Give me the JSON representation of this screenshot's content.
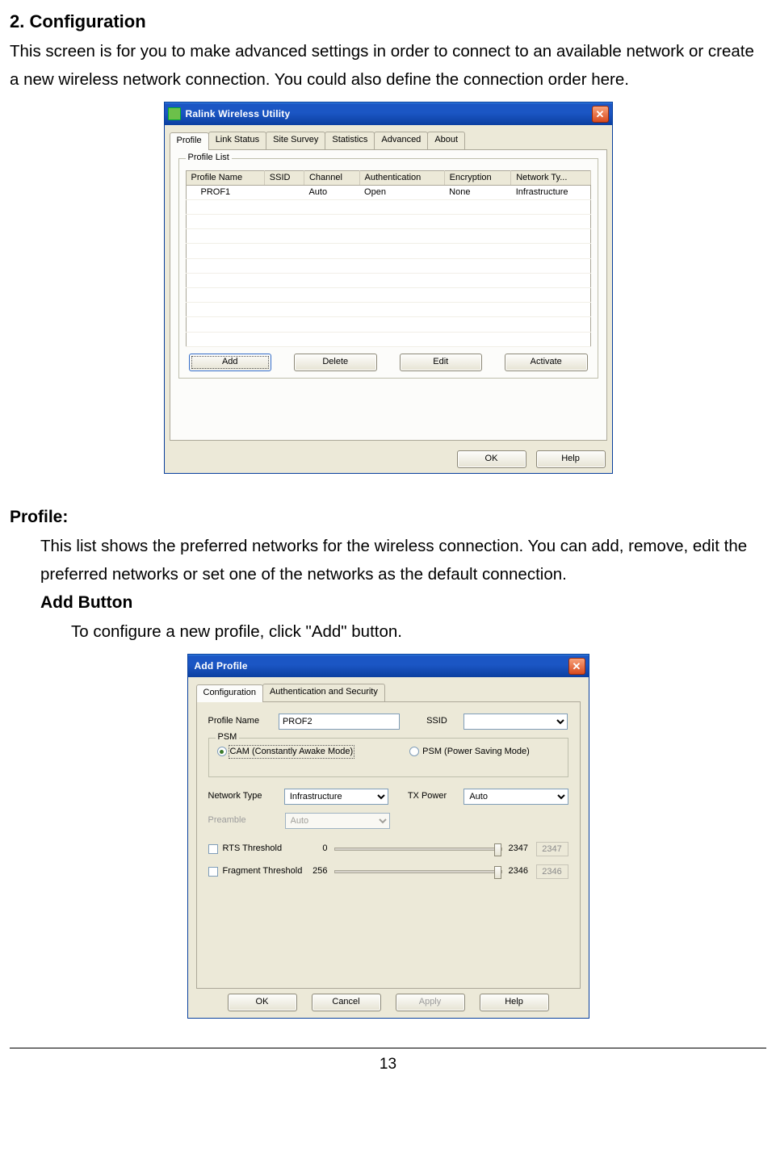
{
  "section": {
    "heading": "2. Configuration",
    "intro": "This screen is for you to make advanced settings in order to connect to an available network or create a new wireless network connection. You could also define the connection order here."
  },
  "profile_section": {
    "heading": "Profile:",
    "text": "This list shows the preferred networks for the wireless connection. You can add, remove, edit the preferred networks or set one of the networks as the default connection.",
    "add_heading": "Add Button",
    "add_text": "To configure a new profile, click \"Add\" button."
  },
  "fig1": {
    "title": "Ralink Wireless Utility",
    "tabs": [
      "Profile",
      "Link Status",
      "Site Survey",
      "Statistics",
      "Advanced",
      "About"
    ],
    "group_label": "Profile List",
    "columns": [
      "Profile Name",
      "SSID",
      "Channel",
      "Authentication",
      "Encryption",
      "Network Ty..."
    ],
    "row": {
      "name": "PROF1",
      "ssid": "",
      "channel": "Auto",
      "auth": "Open",
      "enc": "None",
      "ntype": "Infrastructure"
    },
    "buttons": {
      "add": "Add",
      "delete": "Delete",
      "edit": "Edit",
      "activate": "Activate"
    },
    "bottom": {
      "ok": "OK",
      "help": "Help"
    }
  },
  "fig2": {
    "title": "Add Profile",
    "tabs": [
      "Configuration",
      "Authentication and Security"
    ],
    "labels": {
      "profile_name": "Profile Name",
      "ssid": "SSID",
      "psm_group": "PSM",
      "cam": "CAM (Constantly Awake Mode)",
      "psm": "PSM (Power Saving Mode)",
      "ntype": "Network Type",
      "txpower": "TX Power",
      "preamble": "Preamble",
      "rts": "RTS Threshold",
      "frag": "Fragment Threshold"
    },
    "values": {
      "profile_name": "PROF2",
      "ssid": "",
      "ntype": "Infrastructure",
      "txpower": "Auto",
      "preamble": "Auto",
      "rts_min": "0",
      "rts_max": "2347",
      "rts_val": "2347",
      "frag_min": "256",
      "frag_max": "2346",
      "frag_val": "2346"
    },
    "bottom": {
      "ok": "OK",
      "cancel": "Cancel",
      "apply": "Apply",
      "help": "Help"
    }
  },
  "page_number": "13"
}
